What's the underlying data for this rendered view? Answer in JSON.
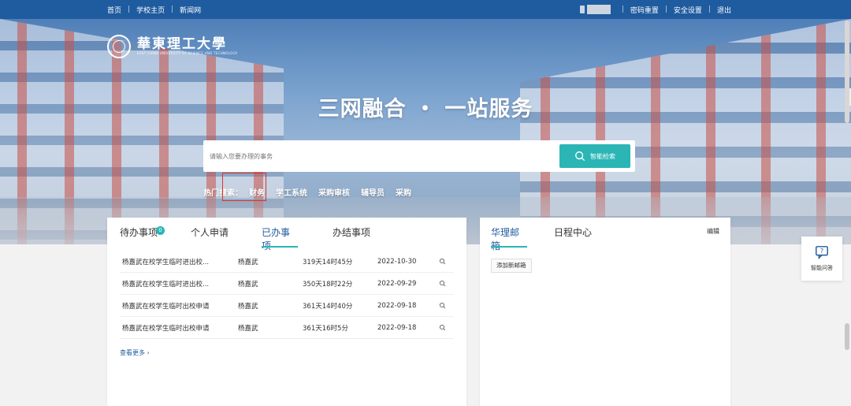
{
  "topbar": {
    "nav": [
      "首页",
      "学校主页",
      "新闻网"
    ],
    "actions": [
      "密码重置",
      "安全设置",
      "退出"
    ],
    "separator": "|"
  },
  "logo": {
    "name": "華東理工大學",
    "subtitle": "EAST CHINA UNIVERSITY OF SCIENCE AND TECHNOLOGY"
  },
  "hero": {
    "slogan": "三网融合 ・ 一站服务"
  },
  "search": {
    "placeholder": "请输入您要办理的事务",
    "button_label": "智能检索"
  },
  "hot_search": {
    "label": "热门搜索：",
    "tags": [
      "财务",
      "学工系统",
      "采购审核",
      "辅导员",
      "采购"
    ]
  },
  "tasks_panel": {
    "tabs": [
      "待办事项",
      "个人申请",
      "已办事项",
      "办结事项"
    ],
    "active_tab": "已办事项",
    "pending_count": "0",
    "rows": [
      {
        "title": "杨嘉武在校学生临时进出校...",
        "person": "杨嘉武",
        "duration": "319天14时45分",
        "date": "2022-10-30"
      },
      {
        "title": "杨嘉武在校学生临时进出校...",
        "person": "杨嘉武",
        "duration": "350天18时22分",
        "date": "2022-09-29"
      },
      {
        "title": "杨嘉武在校学生临时出校申请",
        "person": "杨嘉武",
        "duration": "361天14时40分",
        "date": "2022-09-18"
      },
      {
        "title": "杨嘉武在校学生临时出校申请",
        "person": "杨嘉武",
        "duration": "361天16时5分",
        "date": "2022-09-18"
      }
    ],
    "more_label": "查看更多"
  },
  "mail_panel": {
    "tabs": [
      "华理邮箱",
      "日程中心"
    ],
    "active_tab": "华理邮箱",
    "edit_label": "编辑",
    "add_label": "添加新邮箱"
  },
  "assistant": {
    "label": "智能问答"
  },
  "colors": {
    "topbar": "#1f5b9f",
    "accent": "#2bb5b5",
    "highlight_box": "#e0302a"
  }
}
